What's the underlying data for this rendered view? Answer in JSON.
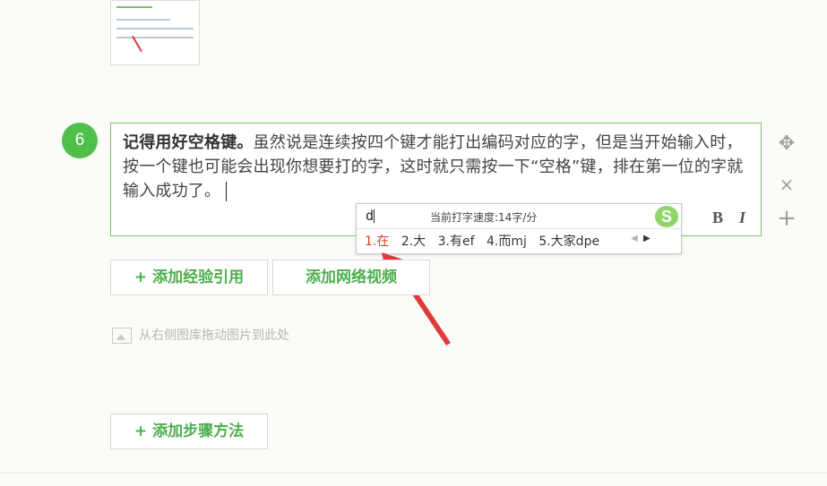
{
  "step": {
    "number": "6"
  },
  "editor": {
    "bold_text": "记得用好空格键。",
    "body_text": "虽然说是连续按四个键才能打出编码对应的字，但是当开始输入时，按一个键也可能会出现你想要打的字，这时就只需按一下“空格”键，排在第一位的字就输入成功了。",
    "bold_button": "B",
    "italic_button": "I"
  },
  "ime": {
    "input": "d",
    "speed": "当前打字速度:14字/分",
    "logo": "S",
    "candidates": [
      "1.在",
      "2.大",
      "3.有ef",
      "4.而mj",
      "5.大家dpe"
    ],
    "prev": "◀",
    "next": "▶"
  },
  "actions": {
    "add_quote": "+ 添加经验引用",
    "add_video": "添加网络视频",
    "drag_hint": "从右侧图库拖动图片到此处",
    "add_step": "+ 添加步骤方法"
  },
  "side_icons": {
    "move": "✥",
    "close": "×",
    "add": "+"
  },
  "colors": {
    "accent": "#4fbf4b",
    "arrow": "#e23a3a",
    "candidate_highlight": "#e0392a"
  }
}
